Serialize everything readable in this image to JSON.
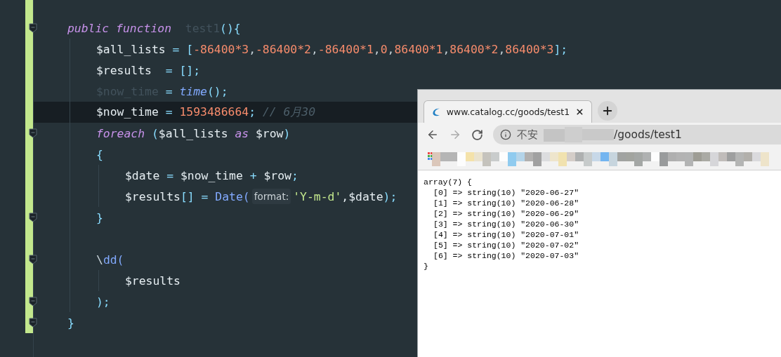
{
  "editor": {
    "lines": [
      {
        "kind": "code",
        "fold": true,
        "current": false,
        "tokens": [
          {
            "text": "public function",
            "kind": "keyword"
          },
          {
            "text": "  test1",
            "kind": "dim"
          },
          {
            "text": "(){",
            "kind": "punct"
          }
        ],
        "children": [
          {
            "kind": "code",
            "fold": false,
            "current": false,
            "tokens": [
              {
                "text": "$all_lists ",
                "kind": "var"
              },
              {
                "text": "= [",
                "kind": "punct"
              },
              {
                "text": "-86400*3",
                "kind": "number"
              },
              {
                "text": ",",
                "kind": "plain"
              },
              {
                "text": "-86400*2",
                "kind": "number"
              },
              {
                "text": ",",
                "kind": "plain"
              },
              {
                "text": "-86400*1",
                "kind": "number"
              },
              {
                "text": ",",
                "kind": "plain"
              },
              {
                "text": "0",
                "kind": "number"
              },
              {
                "text": ",",
                "kind": "plain"
              },
              {
                "text": "86400*1",
                "kind": "number"
              },
              {
                "text": ",",
                "kind": "plain"
              },
              {
                "text": "86400*2",
                "kind": "number"
              },
              {
                "text": ",",
                "kind": "plain"
              },
              {
                "text": "86400*3",
                "kind": "number"
              },
              {
                "text": "];",
                "kind": "punct"
              }
            ]
          },
          {
            "kind": "code",
            "fold": false,
            "current": false,
            "tokens": [
              {
                "text": "$results  ",
                "kind": "var"
              },
              {
                "text": "= [];",
                "kind": "punct"
              }
            ]
          },
          {
            "kind": "code",
            "fold": false,
            "current": false,
            "tokens": [
              {
                "text": "$now_time ",
                "kind": "dim"
              },
              {
                "text": "= ",
                "kind": "punct"
              },
              {
                "text": "time",
                "kind": "func"
              },
              {
                "text": "();",
                "kind": "punct"
              }
            ]
          },
          {
            "kind": "code",
            "fold": false,
            "current": true,
            "tokens": [
              {
                "text": "$now_time ",
                "kind": "var"
              },
              {
                "text": "= ",
                "kind": "punct"
              },
              {
                "text": "1593486664",
                "kind": "number"
              },
              {
                "text": "; ",
                "kind": "punct"
              },
              {
                "text": "// 6月30",
                "kind": "comment"
              }
            ]
          },
          {
            "kind": "code",
            "fold": true,
            "current": false,
            "tokens": [
              {
                "text": "foreach ",
                "kind": "keyword"
              },
              {
                "text": "(",
                "kind": "punct"
              },
              {
                "text": "$all_lists ",
                "kind": "var"
              },
              {
                "text": "as ",
                "kind": "keyword"
              },
              {
                "text": "$row",
                "kind": "var"
              },
              {
                "text": ")",
                "kind": "punct"
              }
            ]
          },
          {
            "kind": "code",
            "fold": false,
            "current": false,
            "tokens": [
              {
                "text": "{",
                "kind": "punct"
              }
            ],
            "children": [
              {
                "kind": "code",
                "fold": false,
                "current": false,
                "tokens": [
                  {
                    "text": "$date ",
                    "kind": "var"
                  },
                  {
                    "text": "= ",
                    "kind": "punct"
                  },
                  {
                    "text": "$now_time ",
                    "kind": "var"
                  },
                  {
                    "text": "+ ",
                    "kind": "punct"
                  },
                  {
                    "text": "$row",
                    "kind": "var"
                  },
                  {
                    "text": ";",
                    "kind": "punct"
                  }
                ]
              },
              {
                "kind": "code",
                "fold": false,
                "current": false,
                "tokens": [
                  {
                    "text": "$results",
                    "kind": "var"
                  },
                  {
                    "text": "[] = ",
                    "kind": "punct"
                  },
                  {
                    "text": "Date(",
                    "kind": "call"
                  },
                  {
                    "text": "format:",
                    "kind": "hint"
                  },
                  {
                    "text": "'Y-m-d'",
                    "kind": "string"
                  },
                  {
                    "text": ",$date",
                    "kind": "var"
                  },
                  {
                    "text": ");",
                    "kind": "punct"
                  }
                ]
              }
            ]
          },
          {
            "kind": "code",
            "fold": true,
            "current": false,
            "tokens": [
              {
                "text": "}",
                "kind": "punct"
              }
            ]
          },
          {
            "kind": "blank",
            "fold": false,
            "current": false
          },
          {
            "kind": "code",
            "fold": true,
            "current": false,
            "tokens": [
              {
                "text": "\\",
                "kind": "plain"
              },
              {
                "text": "dd(",
                "kind": "call"
              }
            ],
            "children": [
              {
                "kind": "code",
                "fold": false,
                "current": false,
                "tokens": [
                  {
                    "text": "$results",
                    "kind": "var"
                  }
                ]
              }
            ]
          },
          {
            "kind": "code",
            "fold": true,
            "current": false,
            "tokens": [
              {
                "text": ");",
                "kind": "punct"
              }
            ]
          }
        ]
      },
      {
        "kind": "code",
        "fold": true,
        "current": false,
        "tokens": [
          {
            "text": "}",
            "kind": "punct"
          }
        ]
      }
    ]
  },
  "browser": {
    "tab": {
      "title": "www.catalog.cc/goods/test1"
    },
    "nav": {
      "back_disabled": false,
      "forward_disabled": true
    },
    "address": {
      "prefix": "不安",
      "path": "/goods/test1"
    },
    "page": {
      "open": "array(7) {",
      "items": [
        "[0] => string(10) \"2020-06-27\"",
        "[1] => string(10) \"2020-06-28\"",
        "[2] => string(10) \"2020-06-29\"",
        "[3] => string(10) \"2020-06-30\"",
        "[4] => string(10) \"2020-07-01\"",
        "[5] => string(10) \"2020-07-02\"",
        "[6] => string(10) \"2020-07-03\""
      ],
      "close": "}"
    }
  }
}
